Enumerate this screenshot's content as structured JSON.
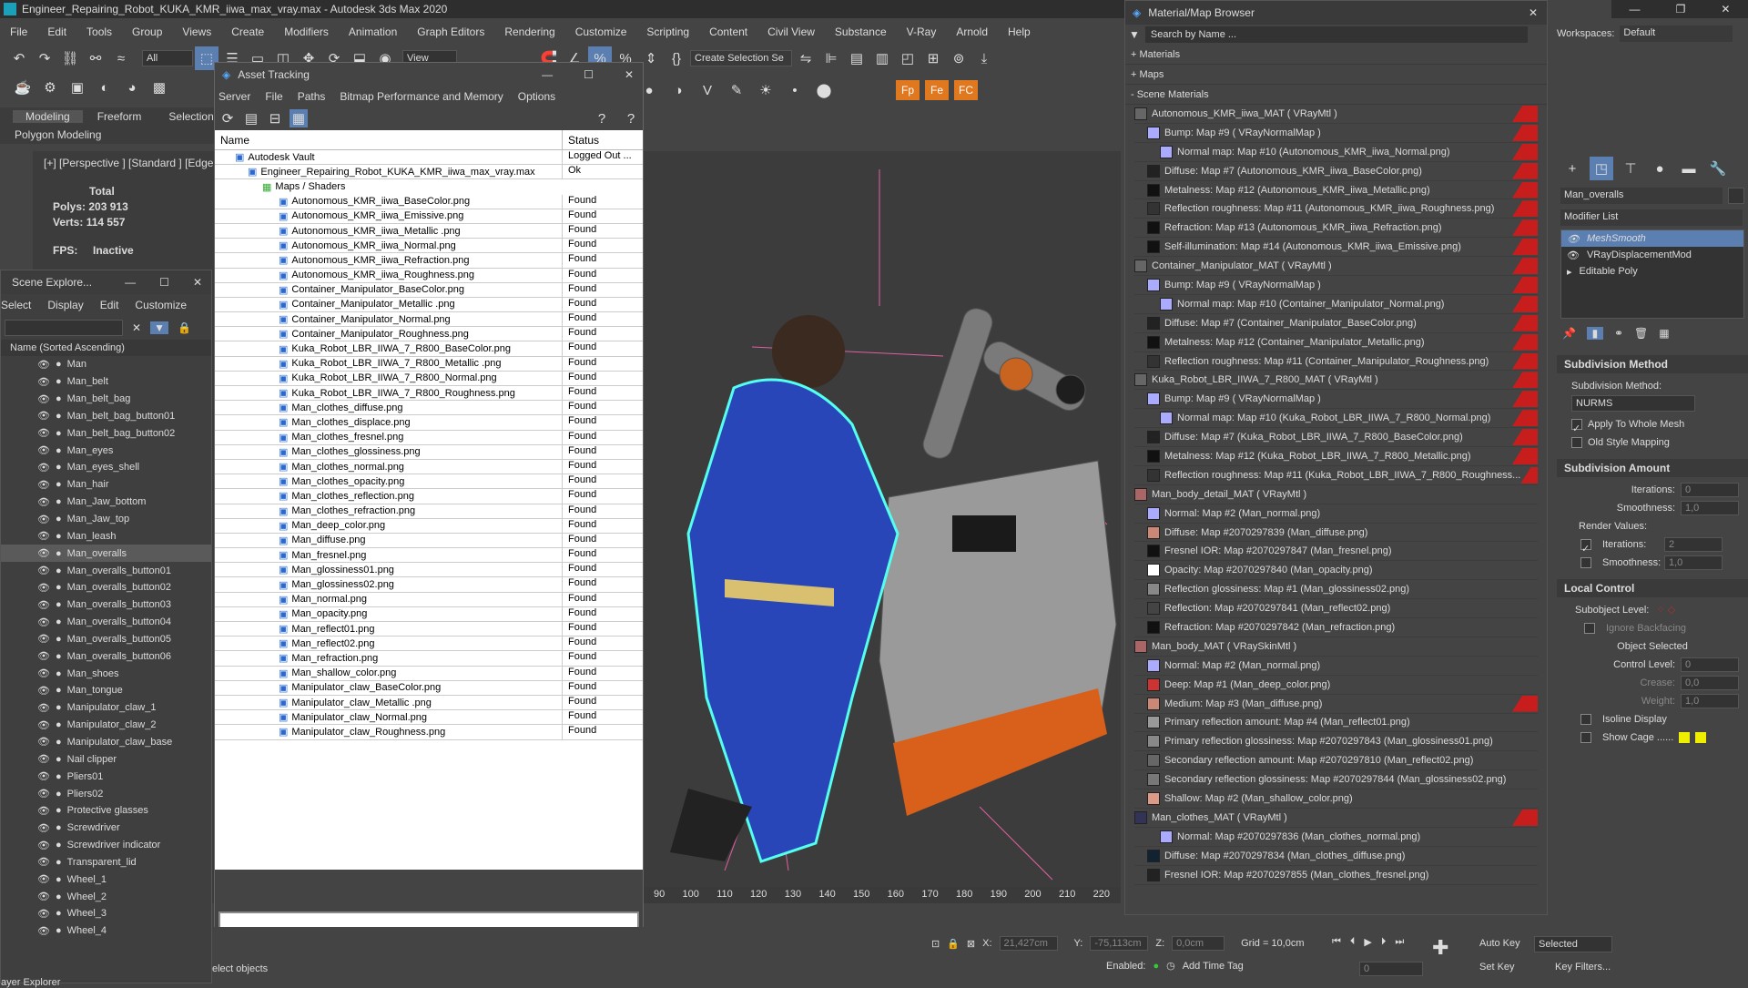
{
  "app": {
    "title": "Engineer_Repairing_Robot_KUKA_KMR_iiwa_max_vray.max - Autodesk 3ds Max 2020",
    "menus": [
      "File",
      "Edit",
      "Tools",
      "Group",
      "Views",
      "Create",
      "Modifiers",
      "Animation",
      "Graph Editors",
      "Rendering",
      "Customize",
      "Scripting",
      "Content",
      "Civil View",
      "Substance",
      "V-Ray",
      "Arnold",
      "Help"
    ]
  },
  "toolbar": {
    "filter": "All",
    "view": "View",
    "selset": "Create Selection Se"
  },
  "ribbon": {
    "tabs": [
      "Modeling",
      "Freeform",
      "Selection"
    ],
    "sub": "Polygon Modeling"
  },
  "viewport": {
    "label": "[+] [Perspective ] [Standard ] [Edged Faces]",
    "stats": {
      "total": "Total",
      "polys_label": "Polys:",
      "polys": "203 913",
      "verts_label": "Verts:",
      "verts": "114 557",
      "fps_label": "FPS:",
      "fps": "Inactive"
    },
    "ruler": [
      "90",
      "100",
      "110",
      "120",
      "130",
      "140",
      "150",
      "160",
      "170",
      "180",
      "190",
      "200",
      "210",
      "220"
    ]
  },
  "scene_explorer": {
    "title": "Scene Explore...",
    "menus": [
      "Select",
      "Display",
      "Edit",
      "Customize"
    ],
    "header": "Name (Sorted Ascending)",
    "selected": "Man_overalls",
    "items": [
      "Man",
      "Man_belt",
      "Man_belt_bag",
      "Man_belt_bag_button01",
      "Man_belt_bag_button02",
      "Man_eyes",
      "Man_eyes_shell",
      "Man_hair",
      "Man_Jaw_bottom",
      "Man_Jaw_top",
      "Man_leash",
      "Man_overalls",
      "Man_overalls_button01",
      "Man_overalls_button02",
      "Man_overalls_button03",
      "Man_overalls_button04",
      "Man_overalls_button05",
      "Man_overalls_button06",
      "Man_shoes",
      "Man_tongue",
      "Manipulator_claw_1",
      "Manipulator_claw_2",
      "Manipulator_claw_base",
      "Nail clipper",
      "Pliers01",
      "Pliers02",
      "Protective glasses",
      "Screwdriver",
      "Screwdriver indicator",
      "Transparent_lid",
      "Wheel_1",
      "Wheel_2",
      "Wheel_3",
      "Wheel_4"
    ],
    "footer": "ayer Explorer"
  },
  "asset_tracking": {
    "title": "Asset Tracking",
    "menus": [
      "Server",
      "File",
      "Paths",
      "Bitmap Performance and Memory",
      "Options"
    ],
    "col_name": "Name",
    "col_status": "Status",
    "vault": "Autodesk Vault",
    "vault_status": "Logged Out ...",
    "file": "Engineer_Repairing_Robot_KUKA_KMR_iiwa_max_vray.max",
    "file_status": "Ok",
    "maps_label": "Maps / Shaders",
    "found": "Found",
    "files": [
      "Autonomous_KMR_iiwa_BaseColor.png",
      "Autonomous_KMR_iiwa_Emissive.png",
      "Autonomous_KMR_iiwa_Metallic .png",
      "Autonomous_KMR_iiwa_Normal.png",
      "Autonomous_KMR_iiwa_Refraction.png",
      "Autonomous_KMR_iiwa_Roughness.png",
      "Container_Manipulator_BaseColor.png",
      "Container_Manipulator_Metallic .png",
      "Container_Manipulator_Normal.png",
      "Container_Manipulator_Roughness.png",
      "Kuka_Robot_LBR_IIWA_7_R800_BaseColor.png",
      "Kuka_Robot_LBR_IIWA_7_R800_Metallic .png",
      "Kuka_Robot_LBR_IIWA_7_R800_Normal.png",
      "Kuka_Robot_LBR_IIWA_7_R800_Roughness.png",
      "Man_clothes_diffuse.png",
      "Man_clothes_displace.png",
      "Man_clothes_fresnel.png",
      "Man_clothes_glossiness.png",
      "Man_clothes_normal.png",
      "Man_clothes_opacity.png",
      "Man_clothes_reflection.png",
      "Man_clothes_refraction.png",
      "Man_deep_color.png",
      "Man_diffuse.png",
      "Man_fresnel.png",
      "Man_glossiness01.png",
      "Man_glossiness02.png",
      "Man_normal.png",
      "Man_opacity.png",
      "Man_reflect01.png",
      "Man_reflect02.png",
      "Man_refraction.png",
      "Man_shallow_color.png",
      "Manipulator_claw_BaseColor.png",
      "Manipulator_claw_Metallic .png",
      "Manipulator_claw_Normal.png",
      "Manipulator_claw_Roughness.png"
    ]
  },
  "material_browser": {
    "title": "Material/Map Browser",
    "search": "Search by Name ...",
    "groups": [
      "+ Materials",
      "+ Maps",
      "- Scene Materials"
    ],
    "rows": [
      {
        "t": "Autonomous_KMR_iiwa_MAT  ( VRayMtl )",
        "l": 0,
        "r": true,
        "c": "#666"
      },
      {
        "t": "Bump: Map #9  ( VRayNormalMap )",
        "l": 1,
        "r": true,
        "c": "#aaf"
      },
      {
        "t": "Normal map: Map #10 (Autonomous_KMR_iiwa_Normal.png)",
        "l": 2,
        "r": true,
        "c": "#aaf"
      },
      {
        "t": "Diffuse: Map #7 (Autonomous_KMR_iiwa_BaseColor.png)",
        "l": 1,
        "r": true,
        "c": "#222"
      },
      {
        "t": "Metalness: Map #12 (Autonomous_KMR_iiwa_Metallic.png)",
        "l": 1,
        "r": true,
        "c": "#111"
      },
      {
        "t": "Reflection roughness: Map #11 (Autonomous_KMR_iiwa_Roughness.png)",
        "l": 1,
        "r": true,
        "c": "#333"
      },
      {
        "t": "Refraction: Map #13 (Autonomous_KMR_iiwa_Refraction.png)",
        "l": 1,
        "r": true,
        "c": "#111"
      },
      {
        "t": "Self-illumination: Map #14 (Autonomous_KMR_iiwa_Emissive.png)",
        "l": 1,
        "r": true,
        "c": "#111"
      },
      {
        "t": "Container_Manipulator_MAT  ( VRayMtl )",
        "l": 0,
        "r": true,
        "c": "#666"
      },
      {
        "t": "Bump: Map #9  ( VRayNormalMap )",
        "l": 1,
        "r": true,
        "c": "#aaf"
      },
      {
        "t": "Normal map: Map #10 (Container_Manipulator_Normal.png)",
        "l": 2,
        "r": true,
        "c": "#aaf"
      },
      {
        "t": "Diffuse: Map #7 (Container_Manipulator_BaseColor.png)",
        "l": 1,
        "r": true,
        "c": "#222"
      },
      {
        "t": "Metalness: Map #12 (Container_Manipulator_Metallic.png)",
        "l": 1,
        "r": true,
        "c": "#111"
      },
      {
        "t": "Reflection roughness: Map #11 (Container_Manipulator_Roughness.png)",
        "l": 1,
        "r": true,
        "c": "#333"
      },
      {
        "t": "Kuka_Robot_LBR_IIWA_7_R800_MAT  ( VRayMtl )",
        "l": 0,
        "r": true,
        "c": "#666"
      },
      {
        "t": "Bump: Map #9  ( VRayNormalMap )",
        "l": 1,
        "r": true,
        "c": "#aaf"
      },
      {
        "t": "Normal map: Map #10 (Kuka_Robot_LBR_IIWA_7_R800_Normal.png)",
        "l": 2,
        "r": true,
        "c": "#aaf"
      },
      {
        "t": "Diffuse: Map #7 (Kuka_Robot_LBR_IIWA_7_R800_BaseColor.png)",
        "l": 1,
        "r": true,
        "c": "#222"
      },
      {
        "t": "Metalness: Map #12 (Kuka_Robot_LBR_IIWA_7_R800_Metallic.png)",
        "l": 1,
        "r": true,
        "c": "#111"
      },
      {
        "t": "Reflection roughness: Map #11 (Kuka_Robot_LBR_IIWA_7_R800_Roughness...",
        "l": 1,
        "r": true,
        "c": "#333"
      },
      {
        "t": "Man_body_detail_MAT  ( VRayMtl )",
        "l": 0,
        "r": false,
        "c": "#a66"
      },
      {
        "t": "Normal: Map #2 (Man_normal.png)",
        "l": 1,
        "r": false,
        "c": "#aaf"
      },
      {
        "t": "Diffuse: Map #2070297839 (Man_diffuse.png)",
        "l": 1,
        "r": false,
        "c": "#c87"
      },
      {
        "t": "Fresnel IOR: Map #2070297847 (Man_fresnel.png)",
        "l": 1,
        "r": false,
        "c": "#111"
      },
      {
        "t": "Opacity: Map #2070297840 (Man_opacity.png)",
        "l": 1,
        "r": false,
        "c": "#fff"
      },
      {
        "t": "Reflection glossiness: Map #1 (Man_glossiness02.png)",
        "l": 1,
        "r": false,
        "c": "#888"
      },
      {
        "t": "Reflection: Map #2070297841 (Man_reflect02.png)",
        "l": 1,
        "r": false,
        "c": "#444"
      },
      {
        "t": "Refraction: Map #2070297842 (Man_refraction.png)",
        "l": 1,
        "r": false,
        "c": "#111"
      },
      {
        "t": "Man_body_MAT  ( VRaySkinMtl )",
        "l": 0,
        "r": false,
        "c": "#a66"
      },
      {
        "t": "Normal: Map #2 (Man_normal.png)",
        "l": 1,
        "r": false,
        "c": "#aaf"
      },
      {
        "t": "Deep: Map #1 (Man_deep_color.png)",
        "l": 1,
        "r": false,
        "c": "#c33"
      },
      {
        "t": "Medium: Map #3 (Man_diffuse.png)",
        "l": 1,
        "r": true,
        "c": "#c87"
      },
      {
        "t": "Primary reflection amount: Map #4 (Man_reflect01.png)",
        "l": 1,
        "r": false,
        "c": "#999"
      },
      {
        "t": "Primary reflection glossiness: Map #2070297843 (Man_glossiness01.png)",
        "l": 1,
        "r": false,
        "c": "#888"
      },
      {
        "t": "Secondary reflection amount: Map #2070297810 (Man_reflect02.png)",
        "l": 1,
        "r": false,
        "c": "#666"
      },
      {
        "t": "Secondary reflection glossiness: Map #2070297844 (Man_glossiness02.png)",
        "l": 1,
        "r": false,
        "c": "#777"
      },
      {
        "t": "Shallow: Map #2 (Man_shallow_color.png)",
        "l": 1,
        "r": false,
        "c": "#d98"
      },
      {
        "t": "Man_clothes_MAT  ( VRayMtl )",
        "l": 0,
        "r": true,
        "c": "#335"
      },
      {
        "t": "Normal: Map #2070297836 (Man_clothes_normal.png)",
        "l": 2,
        "r": false,
        "c": "#aaf"
      },
      {
        "t": "Diffuse: Map #2070297834 (Man_clothes_diffuse.png)",
        "l": 1,
        "r": false,
        "c": "#123"
      },
      {
        "t": "Fresnel IOR: Map #2070297855 (Man_clothes_fresnel.png)",
        "l": 1,
        "r": false,
        "c": "#222"
      }
    ]
  },
  "workspace": {
    "label": "Workspaces:",
    "value": "Default"
  },
  "command_panel": {
    "object_name": "Man_overalls",
    "modifier_list": "Modifier List",
    "stack": [
      "MeshSmooth",
      "VRayDisplacementMod",
      "Editable Poly"
    ],
    "subdiv_method": {
      "head": "Subdivision Method",
      "label": "Subdivision Method:",
      "value": "NURMS",
      "apply": "Apply To Whole Mesh",
      "old": "Old Style Mapping"
    },
    "subdiv_amount": {
      "head": "Subdivision Amount",
      "iter_label": "Iterations:",
      "iter": "0",
      "smooth_label": "Smoothness:",
      "smooth": "1,0",
      "render_label": "Render Values:",
      "r_iter_label": "Iterations:",
      "r_iter": "2",
      "r_smooth_label": "Smoothness:",
      "r_smooth": "1,0"
    },
    "local_control": {
      "head": "Local Control",
      "sublevel": "Subobject Level:",
      "obj_sel": "Object Selected",
      "ignore": "Ignore Backfacing",
      "ctrl_label": "Control Level:",
      "ctrl": "0",
      "crease_label": "Crease:",
      "crease": "0,0",
      "weight_label": "Weight:",
      "weight": "1,0",
      "isoline": "Isoline Display",
      "cage": "Show Cage ......"
    }
  },
  "status": {
    "prompt": "elect objects",
    "x_label": "X:",
    "x": "21,427cm",
    "y_label": "Y:",
    "y": "-75,113cm",
    "z_label": "Z:",
    "z": "0,0cm",
    "grid": "Grid = 10,0cm",
    "enabled": "Enabled:",
    "add_time_tag": "Add Time Tag",
    "frame": "0",
    "auto_key": "Auto Key",
    "set_key": "Set Key",
    "selected": "Selected",
    "key_filters": "Key Filters..."
  }
}
